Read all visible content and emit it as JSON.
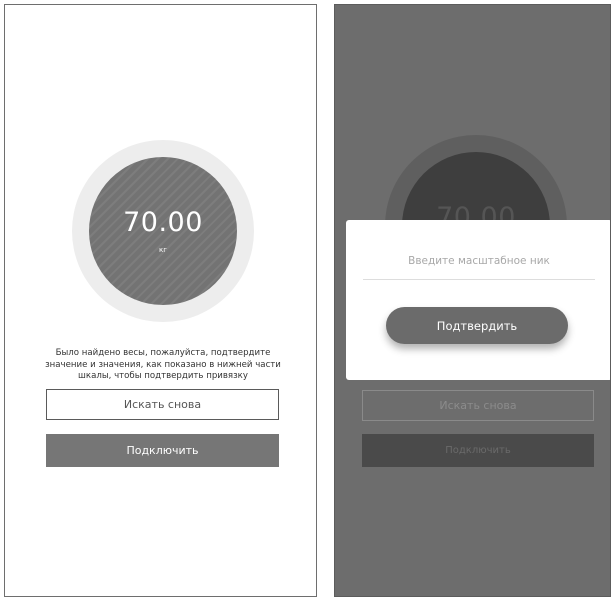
{
  "scale_screen": {
    "weight_value": "70.00",
    "weight_unit": "кг",
    "message": "Было найдено весы, пожалуйста, подтвердите значение и значения, как показано в нижней части шкалы, чтобы подтвердить привязку",
    "search_again_label": "Искать снова",
    "connect_label": "Подключить"
  },
  "nickname_dialog": {
    "input_placeholder": "Введите масштабное ник",
    "confirm_label": "Подтвердить"
  },
  "colors": {
    "dial": "#737373",
    "primary_button": "#767676",
    "overlay": "#6d6d6d"
  }
}
